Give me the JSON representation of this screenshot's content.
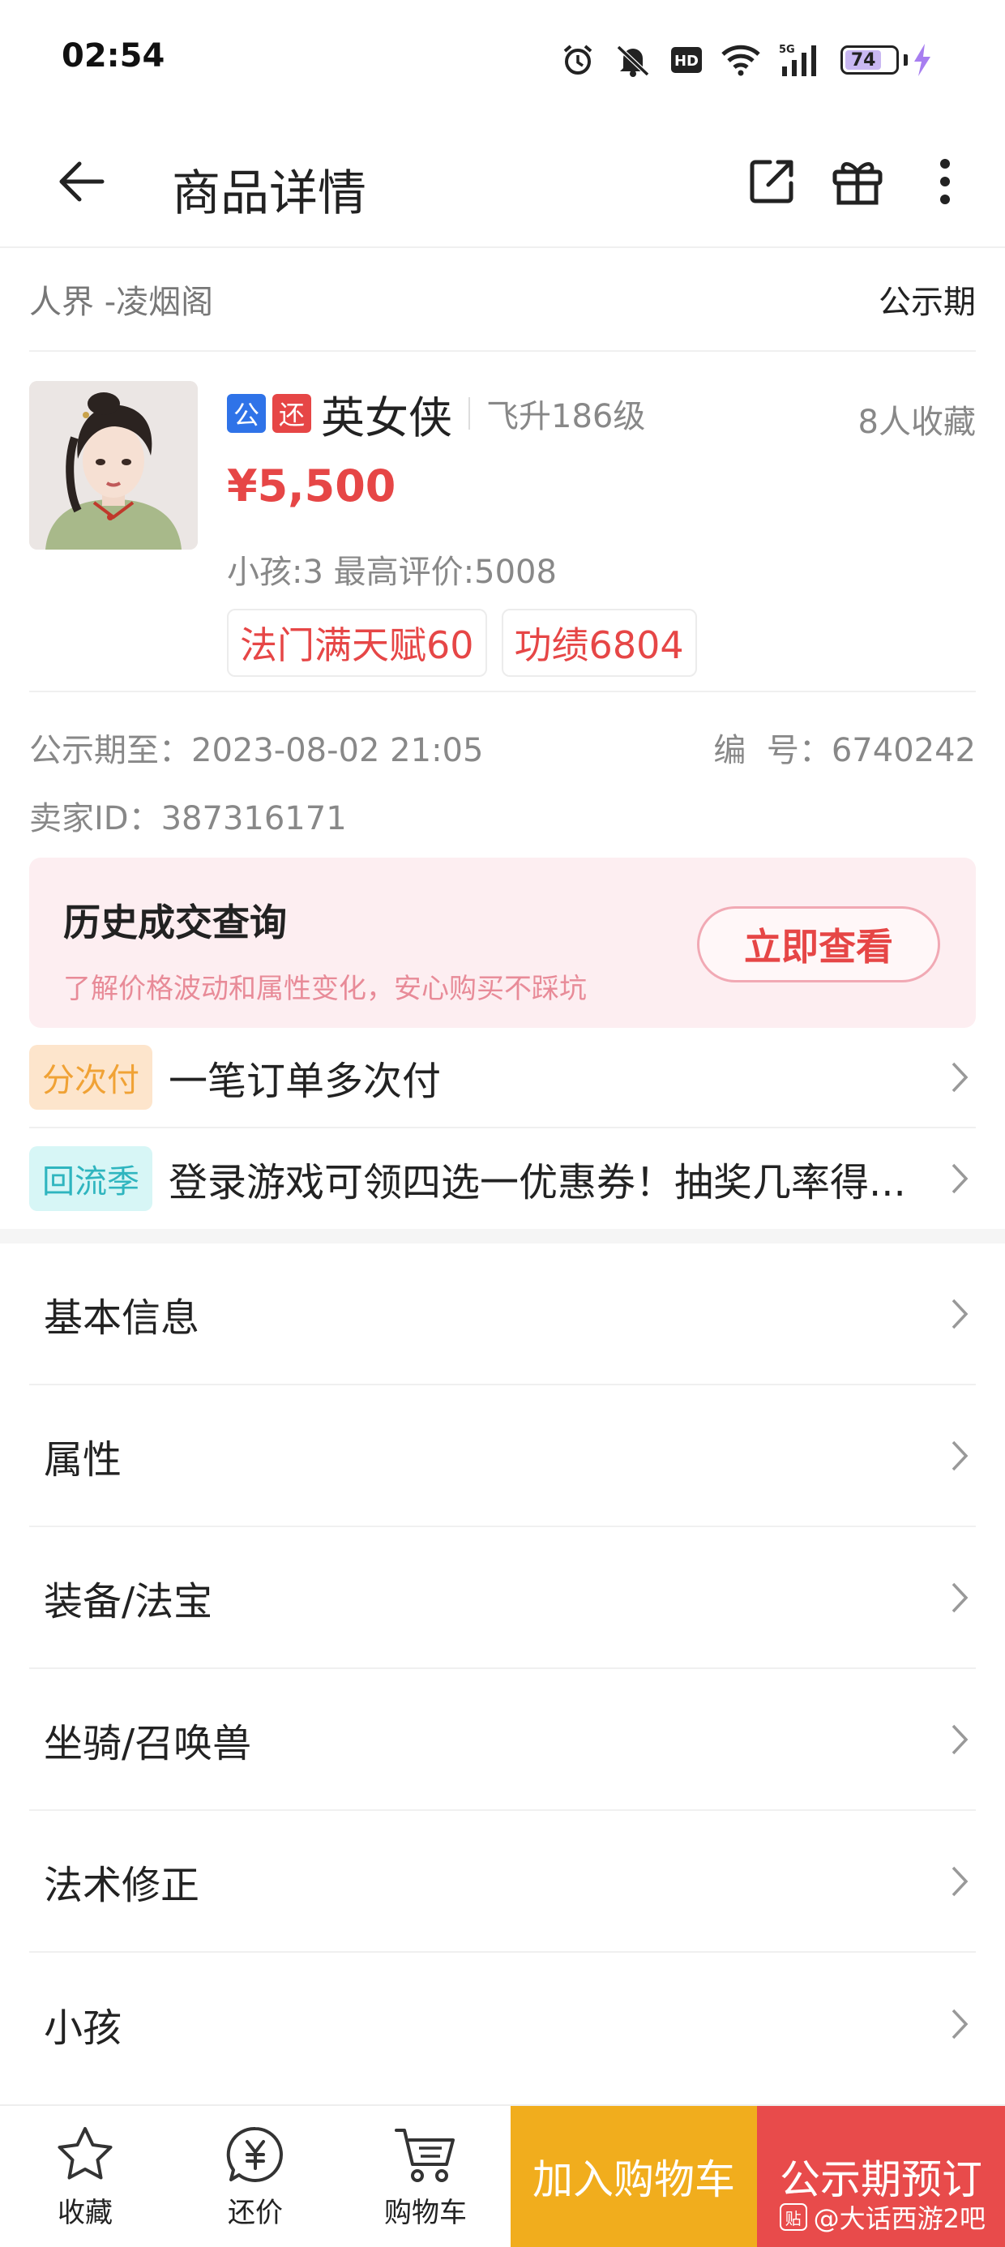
{
  "status_bar": {
    "time": "02:54",
    "battery": "74",
    "network": "5G"
  },
  "header": {
    "title": "商品详情"
  },
  "meta": {
    "server": "人界 -凌烟阁",
    "phase": "公示期"
  },
  "product": {
    "tag_public": "公",
    "tag_bargain": "还",
    "name": "英女侠",
    "level": "飞升186级",
    "favorites": "8人收藏",
    "price": "¥5,500",
    "sub": "小孩:3 最高评价:5008",
    "badges": [
      "法门满天赋60",
      "功绩6804"
    ]
  },
  "info": {
    "deadline": "公示期至：2023-08-02 21:05",
    "number": "编  号：6740242",
    "seller": "卖家ID：387316171"
  },
  "history": {
    "title": "历史成交查询",
    "subtitle": "了解价格波动和属性变化，安心购买不踩坑",
    "button": "立即查看"
  },
  "promos": [
    {
      "tag": "分次付",
      "text": "一笔订单多次付"
    },
    {
      "tag": "回流季",
      "text": "登录游戏可领四选一优惠券！抽奖几率得..."
    }
  ],
  "menu": [
    "基本信息",
    "属性",
    "装备/法宝",
    "坐骑/召唤兽",
    "法术修正",
    "小孩"
  ],
  "bottom": {
    "favorite": "收藏",
    "bargain": "还价",
    "cart": "购物车",
    "add_cart": "加入购物车",
    "preorder": "公示期预订",
    "watermark": "@大话西游2吧",
    "watermark_logo": "贴"
  },
  "colors": {
    "price_red": "#e64646",
    "cart_yellow": "#f1ad1d",
    "preorder_red": "#e84b4b",
    "tag_blue": "#2f73e8"
  }
}
